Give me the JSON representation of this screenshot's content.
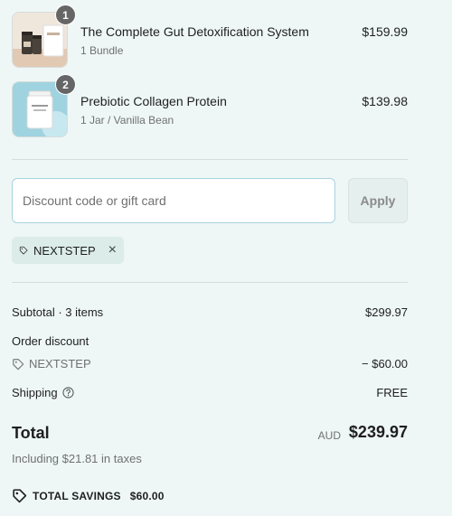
{
  "items": [
    {
      "quantity": "1",
      "name": "The Complete Gut Detoxification System",
      "variant": "1 Bundle",
      "price": "$159.99"
    },
    {
      "quantity": "2",
      "name": "Prebiotic Collagen Protein",
      "variant": "1 Jar / Vanilla Bean",
      "price": "$139.98"
    }
  ],
  "discount": {
    "placeholder": "Discount code or gift card",
    "apply_label": "Apply",
    "applied_code": "NEXTSTEP",
    "remove_icon": "×"
  },
  "summary": {
    "subtotal_label": "Subtotal · 3 items",
    "subtotal_value": "$299.97",
    "order_discount_label": "Order discount",
    "discount_code": "NEXTSTEP",
    "discount_value": "− $60.00",
    "shipping_label": "Shipping",
    "shipping_value": "FREE",
    "total_label": "Total",
    "currency": "AUD",
    "total_value": "$239.97",
    "taxes_note": "Including $21.81 in taxes",
    "savings_label": "TOTAL SAVINGS",
    "savings_value": "$60.00"
  },
  "icons": {
    "tag": "tag-icon",
    "help": "question-circle-icon",
    "close": "close-icon"
  },
  "colors": {
    "background": "#eef7f6",
    "input_border": "#a9d3e2",
    "chip_background": "#dbece9",
    "badge": "#666666"
  }
}
